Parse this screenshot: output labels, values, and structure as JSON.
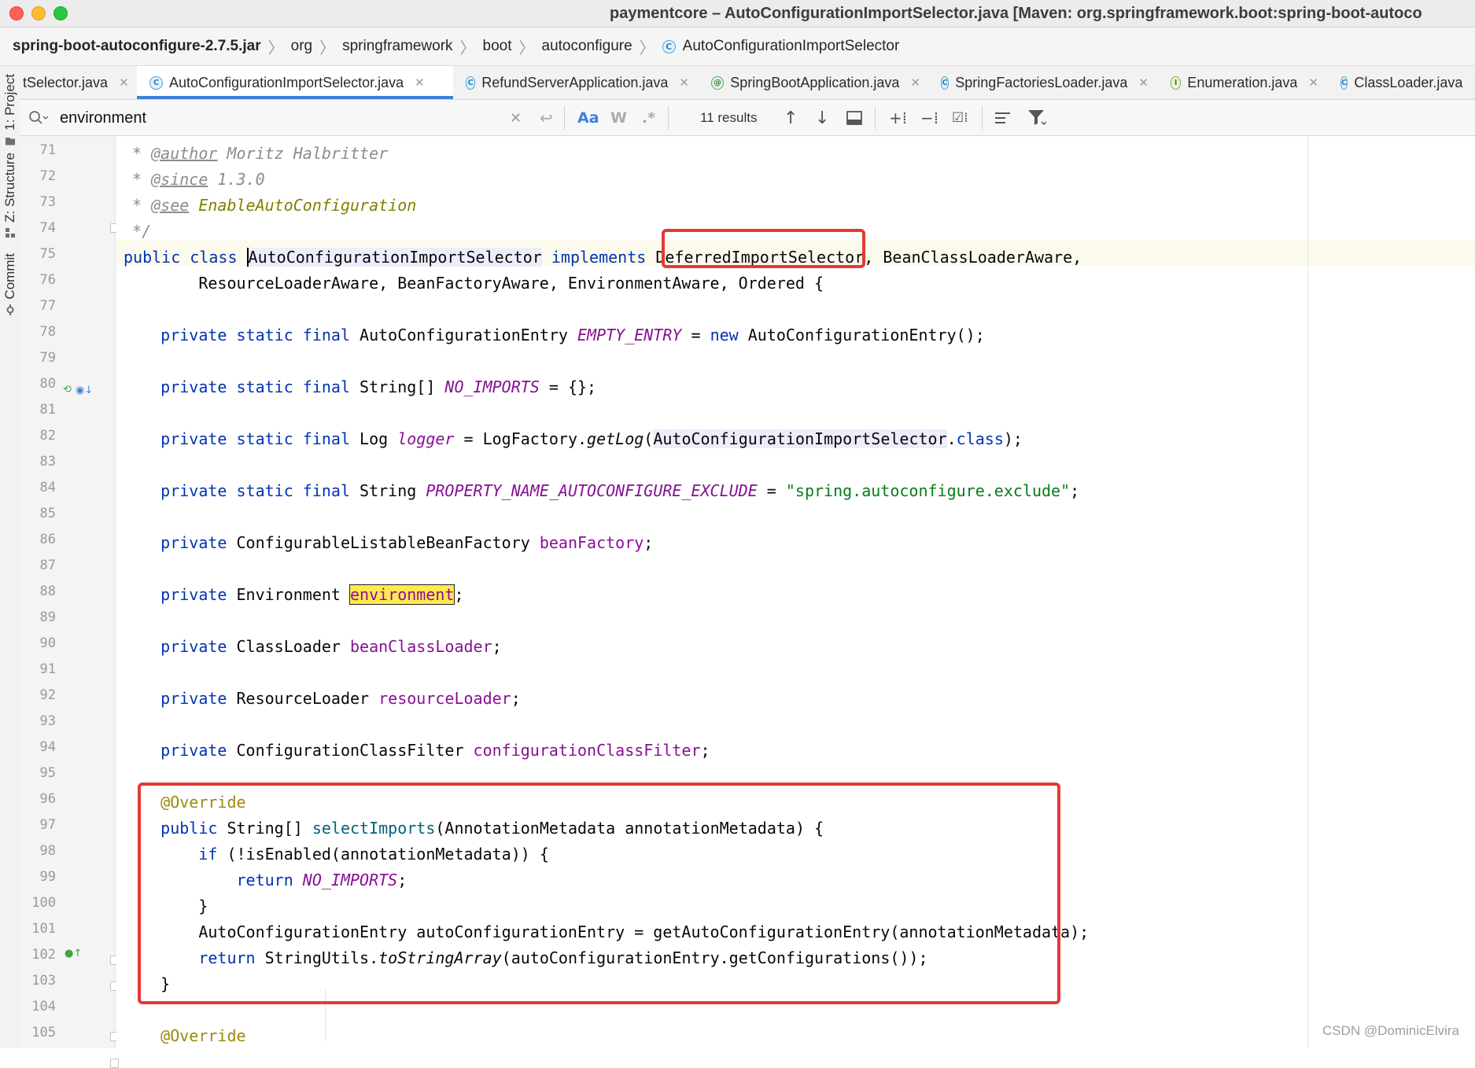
{
  "window": {
    "title": "paymentcore – AutoConfigurationImportSelector.java [Maven: org.springframework.boot:spring-boot-autoco"
  },
  "breadcrumb": [
    "spring-boot-autoconfigure-2.7.5.jar",
    "org",
    "springframework",
    "boot",
    "autoconfigure",
    "AutoConfigurationImportSelector"
  ],
  "toolwindows": {
    "project": "1: Project",
    "structure": "Z: Structure",
    "commit": "Commit"
  },
  "tabs": [
    {
      "label": "tSelector.java",
      "icon": "class-icon",
      "active": false
    },
    {
      "label": "AutoConfigurationImportSelector.java",
      "icon": "class-icon",
      "active": true
    },
    {
      "label": "RefundServerApplication.java",
      "icon": "spring-class-icon",
      "active": false
    },
    {
      "label": "SpringBootApplication.java",
      "icon": "annotation-icon",
      "active": false
    },
    {
      "label": "SpringFactoriesLoader.java",
      "icon": "class-icon",
      "active": false
    },
    {
      "label": "Enumeration.java",
      "icon": "interface-icon",
      "active": false
    },
    {
      "label": "ClassLoader.java",
      "icon": "class-icon",
      "active": false
    }
  ],
  "find": {
    "query": "environment",
    "match_case_label": "Aa",
    "words_label": "W",
    "regex_label": ".*",
    "results": "11 results"
  },
  "line_numbers": [
    "71",
    "72",
    "73",
    "74",
    "75",
    "76",
    "77",
    "78",
    "79",
    "80",
    "81",
    "82",
    "83",
    "84",
    "85",
    "86",
    "87",
    "88",
    "89",
    "90",
    "91",
    "92",
    "93",
    "94",
    "95",
    "96",
    "97",
    "98",
    "99",
    "100",
    "101",
    "102",
    "103",
    "104",
    "105"
  ],
  "code": {
    "l71": [
      " * ",
      "@author",
      " Moritz Halbritter"
    ],
    "l72": [
      " * ",
      "@since",
      " 1.3.0"
    ],
    "l73": [
      " * ",
      "@see",
      " ",
      "EnableAutoConfiguration"
    ],
    "l74": [
      " */"
    ],
    "l75": [
      "public class ",
      "AutoConfigurationImportSelector",
      " ",
      "implements",
      " DeferredImportSelector, BeanClassLoaderAware,"
    ],
    "l76": [
      "        ResourceLoaderAware, BeanFactoryAware, EnvironmentAware, Ordered {"
    ],
    "l78": [
      "    ",
      "private static final",
      " AutoConfigurationEntry ",
      "EMPTY_ENTRY",
      " = ",
      "new",
      " AutoConfigurationEntry();"
    ],
    "l80": [
      "    ",
      "private static final",
      " String[] ",
      "NO_IMPORTS",
      " = {};"
    ],
    "l82": [
      "    ",
      "private static final",
      " Log ",
      "logger",
      " = LogFactory.",
      "getLog",
      "(",
      "AutoConfigurationImportSelector",
      ".",
      "class",
      ");"
    ],
    "l84": [
      "    ",
      "private static final",
      " String ",
      "PROPERTY_NAME_AUTOCONFIGURE_EXCLUDE",
      " = ",
      "\"spring.autoconfigure.exclude\"",
      ";"
    ],
    "l86": [
      "    ",
      "private",
      " ConfigurableListableBeanFactory ",
      "beanFactory",
      ";"
    ],
    "l88": [
      "    ",
      "private",
      " Environment ",
      "environment",
      ";"
    ],
    "l90": [
      "    ",
      "private",
      " ClassLoader ",
      "beanClassLoader",
      ";"
    ],
    "l92": [
      "    ",
      "private",
      " ResourceLoader ",
      "resourceLoader",
      ";"
    ],
    "l94": [
      "    ",
      "private",
      " ConfigurationClassFilter ",
      "configurationClassFilter",
      ";"
    ],
    "l96": [
      "    ",
      "@Override"
    ],
    "l97": [
      "    ",
      "public",
      " String[] ",
      "selectImports",
      "(AnnotationMetadata annotationMetadata) {"
    ],
    "l98": [
      "        ",
      "if",
      " (!isEnabled(annotationMetadata)) {"
    ],
    "l99": [
      "            ",
      "return",
      " ",
      "NO_IMPORTS",
      ";"
    ],
    "l100": [
      "        }"
    ],
    "l101": [
      "        AutoConfigurationEntry autoConfigurationEntry = getAutoConfigurationEntry(annotationMetadata);"
    ],
    "l102": [
      "        ",
      "return",
      " StringUtils.",
      "toStringArray",
      "(autoConfigurationEntry.getConfigurations());"
    ],
    "l103": [
      "    }"
    ],
    "l105": [
      "    ",
      "@Override"
    ]
  },
  "watermark": "CSDN @DominicElvira",
  "colors": {
    "keyword": "#0033b3",
    "static_field": "#871094",
    "string": "#067d17",
    "annotation": "#9e880d",
    "comment": "#8c8c8c",
    "search_highlight": "#ffe94f",
    "annotation_box": "#e53935",
    "active_tab_underline": "#3f7fd9"
  }
}
